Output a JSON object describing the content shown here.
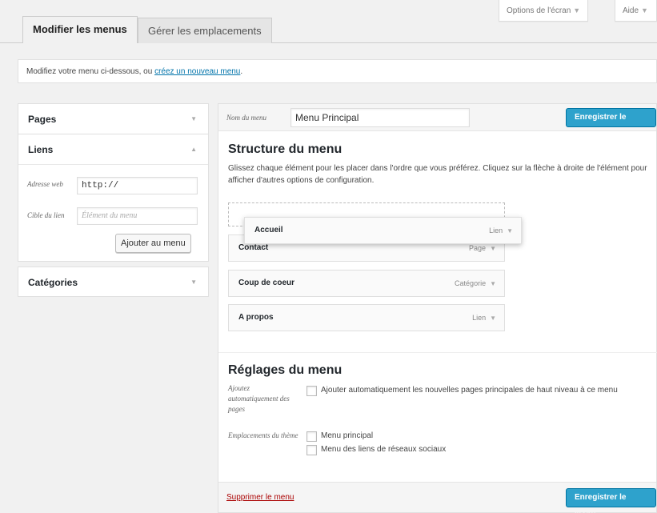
{
  "screen_meta": {
    "options_label": "Options de l'écran",
    "help_label": "Aide",
    "arrow": "▼"
  },
  "tabs": [
    {
      "label": "Modifier les menus",
      "active": true
    },
    {
      "label": "Gérer les emplacements",
      "active": false
    }
  ],
  "notice": {
    "text": "Modifiez votre menu ci-dessous, ou ",
    "link": "créez un nouveau menu",
    "suffix": "."
  },
  "accordion": {
    "pages": {
      "title": "Pages",
      "icon": "chevron-down-icon"
    },
    "links": {
      "title": "Liens",
      "icon": "chevron-up-icon",
      "url_label": "Adresse web",
      "url_value": "http://",
      "link_text_label": "Cible du lien",
      "link_text_placeholder": "Élément du menu",
      "add_button": "Ajouter au menu"
    },
    "categories": {
      "title": "Catégories",
      "icon": "chevron-down-icon"
    }
  },
  "menu": {
    "name_label": "Nom du menu",
    "name_value": "Menu Principal",
    "save_label": "Enregistrer le menu",
    "structure_title": "Structure du menu",
    "structure_desc": "Glissez chaque élément pour les placer dans l'ordre que vous préférez. Cliquez sur la flèche à droite de l'élément pour afficher d'autres options de configuration.",
    "items": [
      {
        "title": "Accueil",
        "type": "Lien",
        "dragging": true
      },
      {
        "title": "Contact",
        "type": "Page"
      },
      {
        "title": "Coup de coeur",
        "type": "Catégorie"
      },
      {
        "title": "A propos",
        "type": "Lien"
      }
    ],
    "settings_title": "Réglages du menu",
    "auto_add_label": "Ajoutez automatiquement des pages",
    "auto_add_option": "Ajouter automatiquement les nouvelles pages principales de haut niveau à ce menu",
    "locations_label": "Emplacements du thème",
    "locations": [
      "Menu principal",
      "Menu des liens de réseaux sociaux"
    ],
    "delete_label": "Supprimer le menu"
  },
  "colors": {
    "primary": "#2ea2cc",
    "link": "#0073aa",
    "delete": "#aa0000"
  }
}
